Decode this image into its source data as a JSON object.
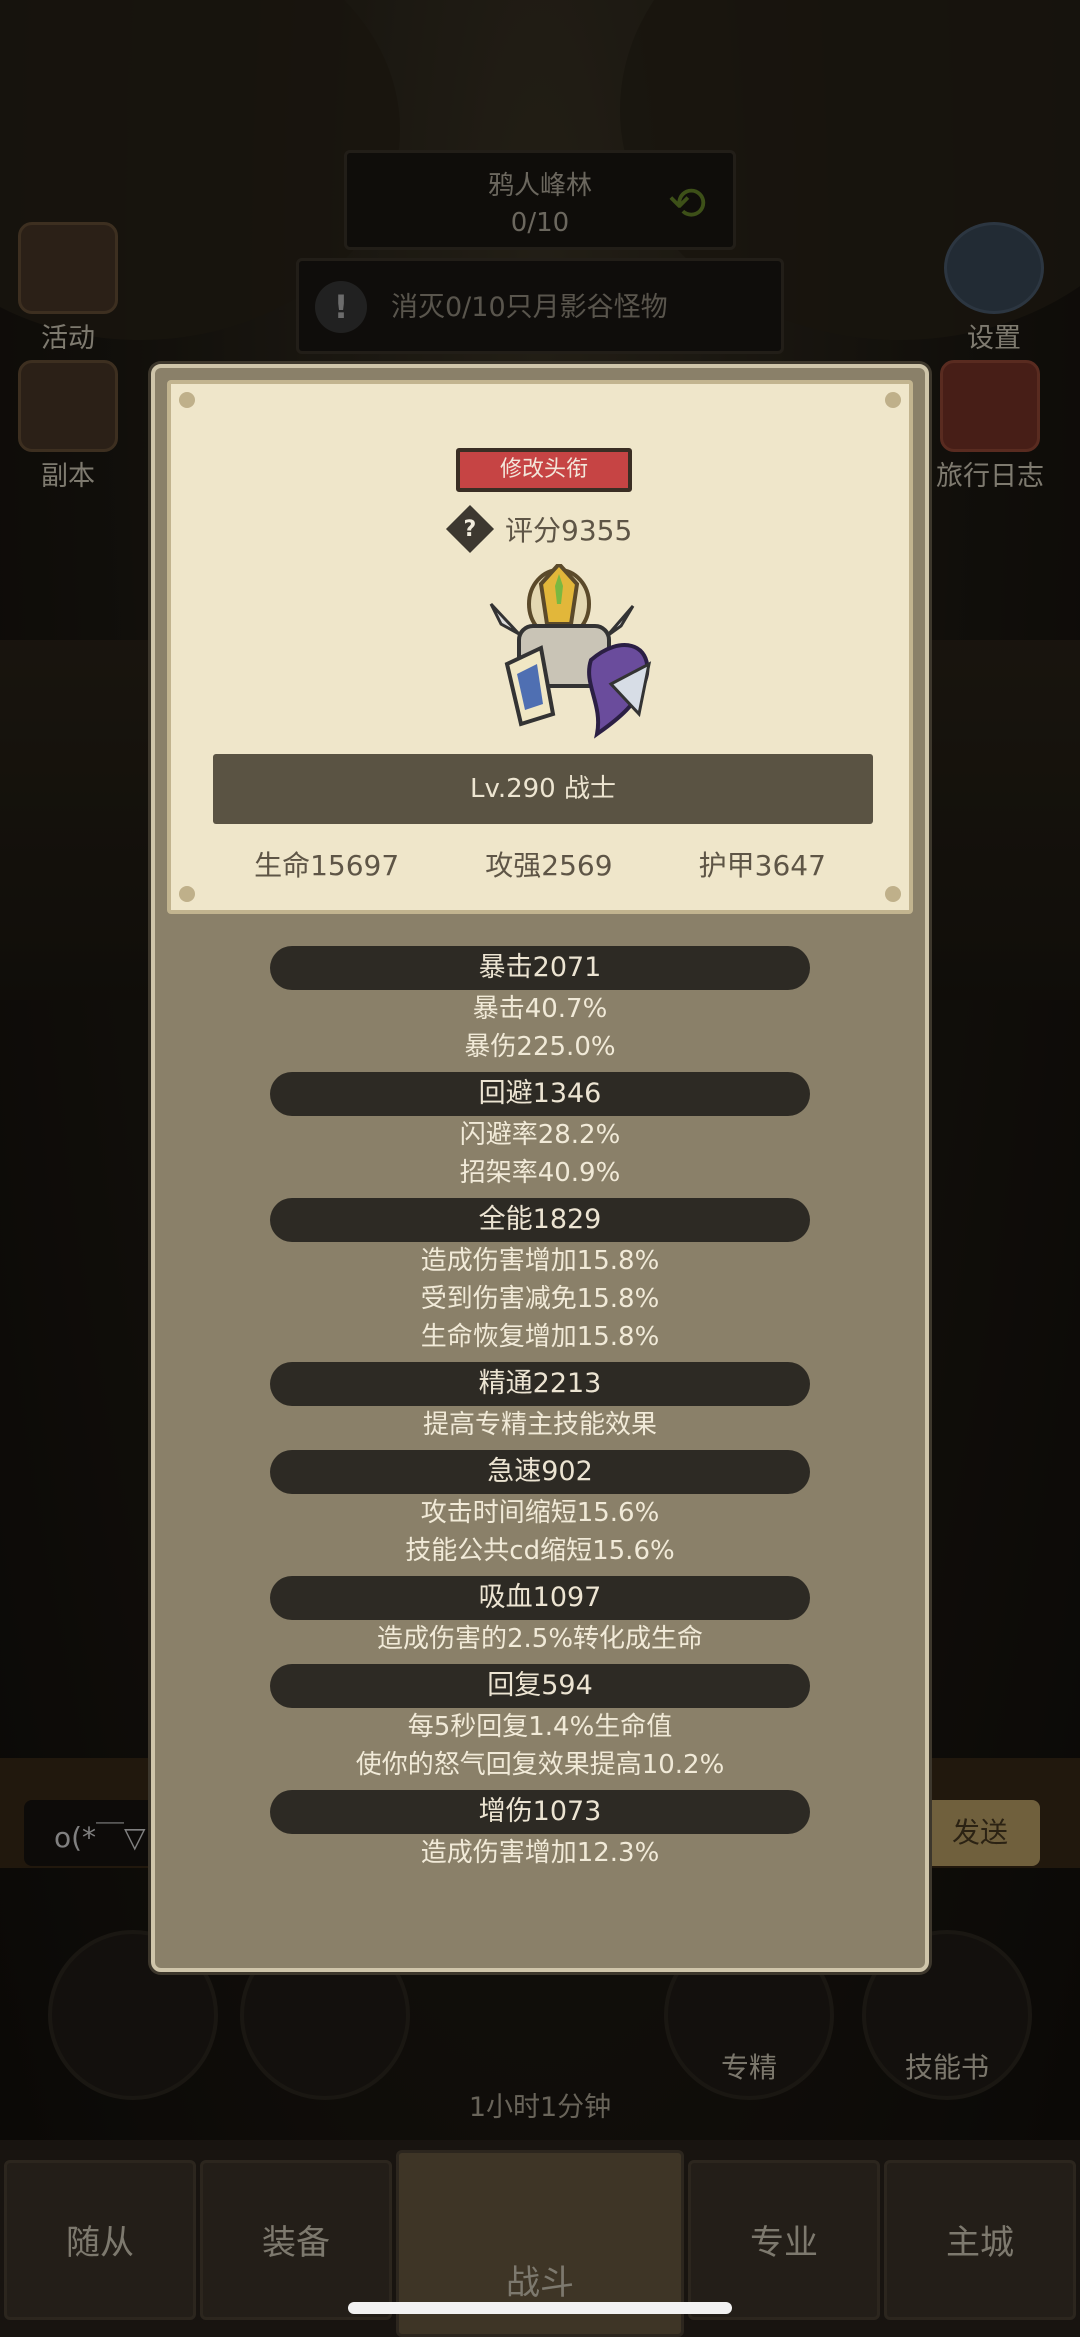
{
  "location": {
    "name": "鸦人峰林",
    "progress": "0/10"
  },
  "quest": {
    "text": "消灭0/10只月影谷怪物"
  },
  "left_buttons": [
    {
      "label": "活动"
    },
    {
      "label": "副本"
    }
  ],
  "right_buttons": [
    {
      "label": "设置"
    },
    {
      "label": "旅行日志"
    }
  ],
  "chat": {
    "input_text": "o(*￣▽",
    "send_label": "发送"
  },
  "bottom_actions": [
    {
      "label": "专精"
    },
    {
      "label": "技能书"
    }
  ],
  "timer": {
    "text": "1小时1分钟"
  },
  "nav_tabs": [
    {
      "label": "随从"
    },
    {
      "label": "装备"
    },
    {
      "label": "战斗"
    },
    {
      "label": "专业"
    },
    {
      "label": "主城"
    }
  ],
  "panel": {
    "title_button": "修改头衔",
    "score_icon": "?",
    "score": "评分9355",
    "level_text": "Lv.290 战士",
    "base_stats": [
      "生命15697",
      "攻强2569",
      "护甲3647"
    ],
    "groups": [
      {
        "head": "暴击2071",
        "lines": [
          "暴击40.7%",
          "暴伤225.0%"
        ]
      },
      {
        "head": "回避1346",
        "lines": [
          "闪避率28.2%",
          "招架率40.9%"
        ]
      },
      {
        "head": "全能1829",
        "lines": [
          "造成伤害增加15.8%",
          "受到伤害减免15.8%",
          "生命恢复增加15.8%"
        ]
      },
      {
        "head": "精通2213",
        "lines": [
          "提高专精主技能效果"
        ]
      },
      {
        "head": "急速902",
        "lines": [
          "攻击时间缩短15.6%",
          "技能公共cd缩短15.6%"
        ]
      },
      {
        "head": "吸血1097",
        "lines": [
          "造成伤害的2.5%转化成生命"
        ]
      },
      {
        "head": "回复594",
        "lines": [
          "每5秒回复1.4%生命值",
          "使你的怒气回复效果提高10.2%"
        ]
      },
      {
        "head": "增伤1073",
        "lines": [
          "造成伤害增加12.3%"
        ]
      }
    ]
  }
}
